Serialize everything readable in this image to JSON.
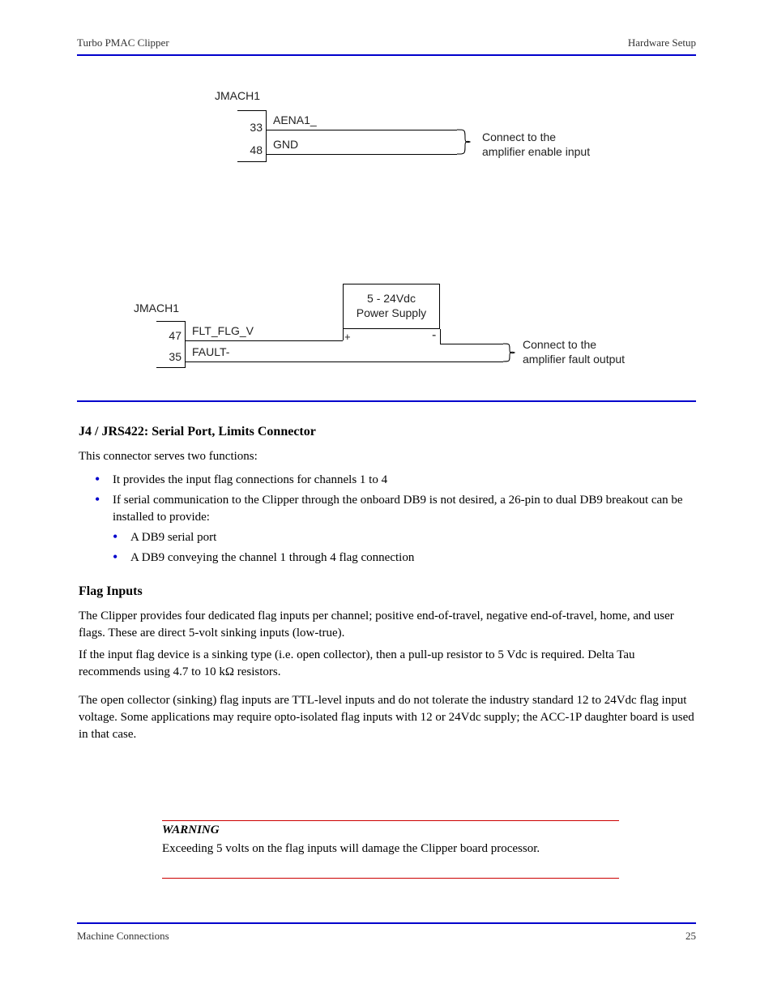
{
  "header": {
    "left": "Turbo PMAC Clipper",
    "right": "Hardware Setup"
  },
  "footer": {
    "left": "Machine Connections",
    "right": "25"
  },
  "diagram1": {
    "title": "JMACH1",
    "row1_pin": "33",
    "row1_sig": "AENA1_",
    "row2_pin": "48",
    "row2_sig": "GND",
    "note_l1": "Connect to the",
    "note_l2": "amplifier enable input"
  },
  "diagram2": {
    "title": "JMACH1",
    "row1_pin": "47",
    "row1_sig": "FLT_FLG_V",
    "row2_pin": "35",
    "row2_sig": "FAULT-",
    "ps_line1": "5 - 24Vdc",
    "ps_line2": "Power Supply",
    "plus": "+",
    "minus": "-",
    "note_l1": "Connect to the",
    "note_l2": "amplifier fault output"
  },
  "section": {
    "title": "J4 / JRS422: Serial Port, Limits Connector",
    "intro": "This connector serves two functions:",
    "b1": "It provides the input flag connections for channels 1 to 4",
    "b2": "If serial communication to the Clipper through the onboard DB9 is not desired, a 26-pin to dual DB9 breakout can be installed to provide:",
    "b3": "A DB9 serial port",
    "b4": "A DB9 conveying the channel 1 through 4 flag connection",
    "h_flags": "Flag Inputs",
    "flags_p": "The Clipper provides four dedicated flag inputs per channel; positive end-of-travel, negative end-of-travel, home, and user flags. These are direct 5-volt sinking inputs (low-true).",
    "flags_p2": "If the input flag device is a sinking type (i.e. open collector), then a pull-up resistor to 5 Vdc is required. Delta Tau recommends using 4.7 to 10 kΩ resistors.",
    "flags_p3": "The open collector (sinking) flag inputs are TTL-level inputs and do not tolerate the industry standard 12 to 24Vdc flag input voltage. Some applications may require opto-isolated flag inputs with 12 or 24Vdc supply; the ACC-1P daughter board is used in that case."
  },
  "warning": {
    "label": "WARNING",
    "body": "Exceeding 5 volts on the flag inputs will damage the Clipper board processor."
  }
}
